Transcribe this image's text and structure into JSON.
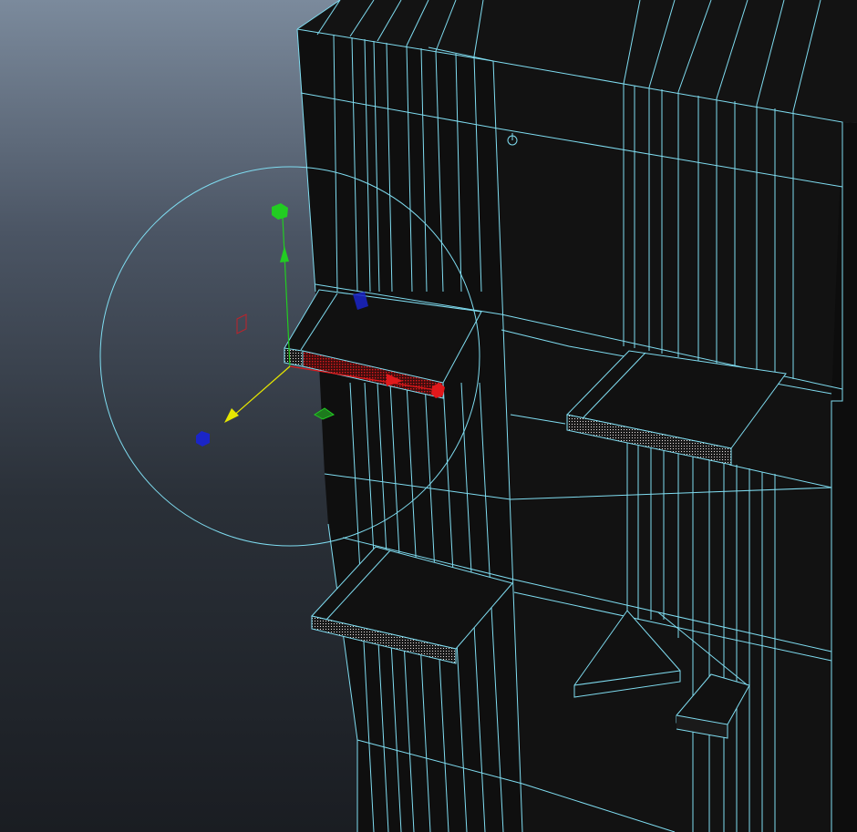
{
  "viewport": {
    "kind": "3d-modeling-perspective-viewport",
    "shading": "wireframe-on-shaded",
    "background_top": "#7b8a9c",
    "background_bottom": "#1a1d22"
  },
  "colors": {
    "wireframe": "#7fdcf0",
    "model_fill": "#111111",
    "selection_red": "#e0191c",
    "axis_x": "#e0191c",
    "axis_y": "#22cc22",
    "axis_z": "#1a25c8",
    "manip_center_axis": "#e6e600",
    "manip_ring": "#7fdcf0"
  },
  "icons": {
    "pivot": "pivot-icon",
    "manipulator": "move-manipulator"
  },
  "selection": {
    "component_mode": "face",
    "selected_object": "upper-left-balcony-slab"
  }
}
